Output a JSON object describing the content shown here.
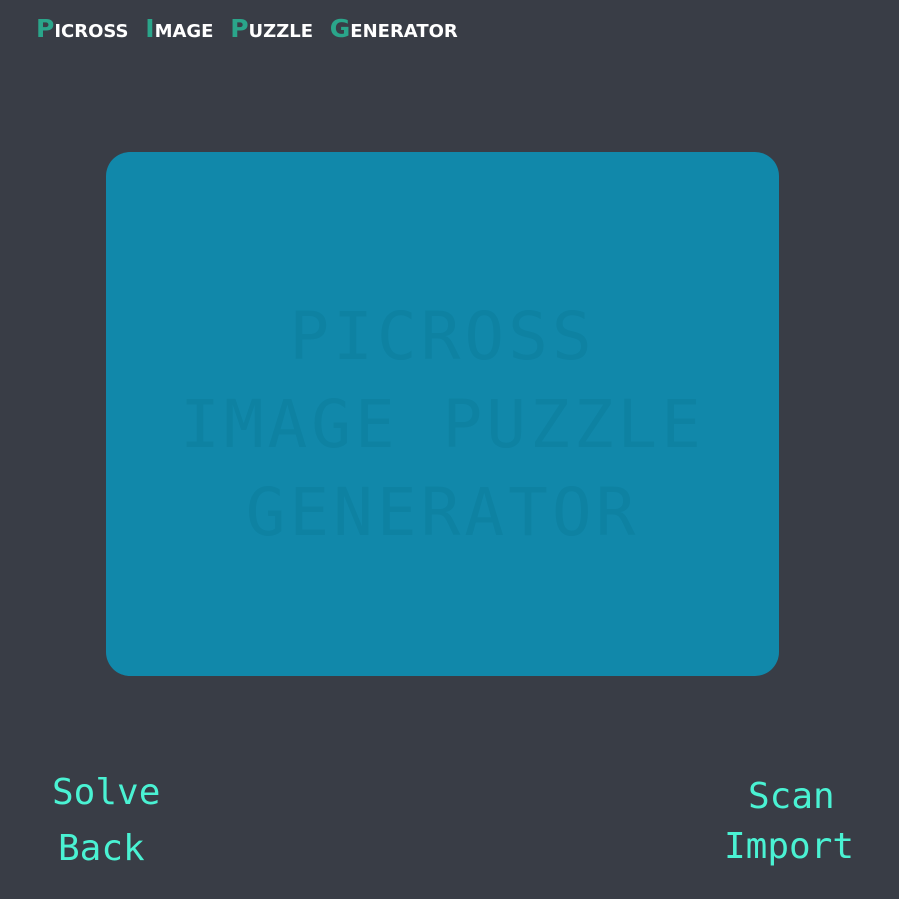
{
  "app": {
    "title_words": [
      {
        "initial": "P",
        "rest": "icross"
      },
      {
        "initial": "I",
        "rest": "mage"
      },
      {
        "initial": "P",
        "rest": "uzzle"
      },
      {
        "initial": "G",
        "rest": "enerator"
      }
    ],
    "colors": {
      "background": "#393d46",
      "accent": "#2aa58a",
      "panel": "#1188aa",
      "button_text": "#4af2d3"
    }
  },
  "preview": {
    "watermark_lines": [
      "PICROSS",
      "IMAGE PUZZLE",
      "GENERATOR"
    ]
  },
  "actions": {
    "solve_label": "Solve",
    "back_label": "Back",
    "scan_label": "Scan",
    "import_label": "Import"
  }
}
